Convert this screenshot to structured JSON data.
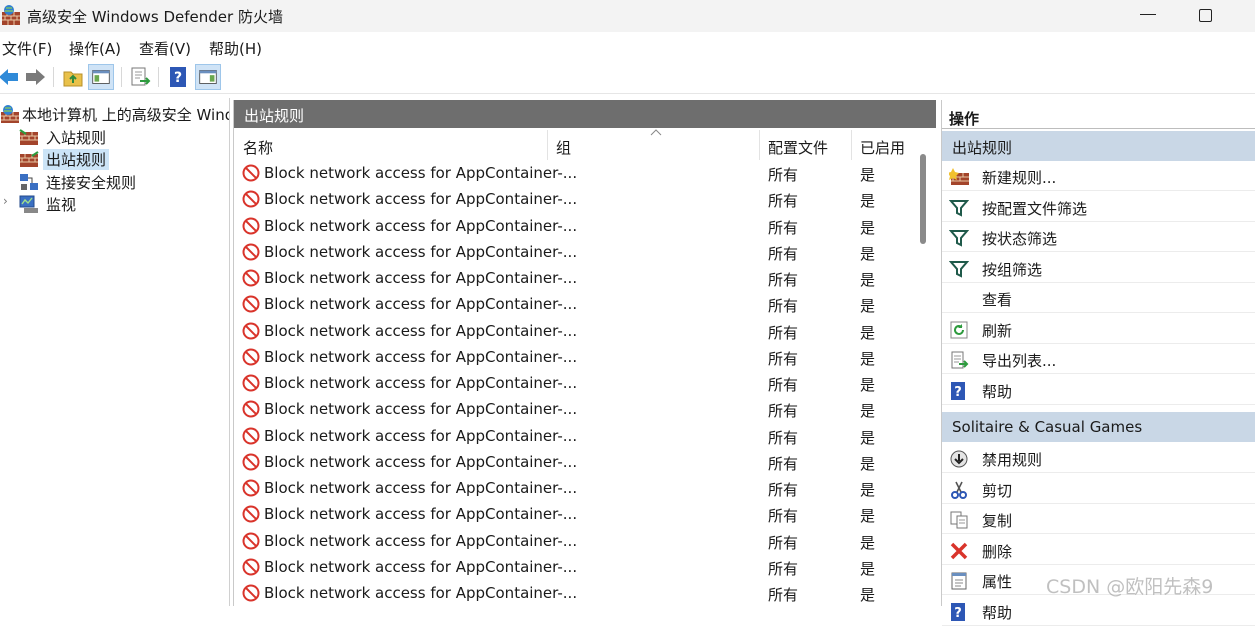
{
  "window": {
    "title": "高级安全 Windows Defender 防火墙"
  },
  "menu": [
    "文件(F)",
    "操作(A)",
    "查看(V)",
    "帮助(H)"
  ],
  "tree": {
    "root": "本地计算机 上的高级安全 Windows Defender 防火墙",
    "items": [
      "入站规则",
      "出站规则",
      "连接安全规则",
      "监视"
    ],
    "selected": "出站规则"
  },
  "panel": {
    "title": "出站规则",
    "columns": [
      "名称",
      "组",
      "配置文件",
      "已启用"
    ],
    "rows": [
      {
        "name": "Block network access for AppContainer-...",
        "group": "",
        "profile": "所有",
        "enabled": "是"
      },
      {
        "name": "Block network access for AppContainer-...",
        "group": "",
        "profile": "所有",
        "enabled": "是"
      },
      {
        "name": "Block network access for AppContainer-...",
        "group": "",
        "profile": "所有",
        "enabled": "是"
      },
      {
        "name": "Block network access for AppContainer-...",
        "group": "",
        "profile": "所有",
        "enabled": "是"
      },
      {
        "name": "Block network access for AppContainer-...",
        "group": "",
        "profile": "所有",
        "enabled": "是"
      },
      {
        "name": "Block network access for AppContainer-...",
        "group": "",
        "profile": "所有",
        "enabled": "是"
      },
      {
        "name": "Block network access for AppContainer-...",
        "group": "",
        "profile": "所有",
        "enabled": "是"
      },
      {
        "name": "Block network access for AppContainer-...",
        "group": "",
        "profile": "所有",
        "enabled": "是"
      },
      {
        "name": "Block network access for AppContainer-...",
        "group": "",
        "profile": "所有",
        "enabled": "是"
      },
      {
        "name": "Block network access for AppContainer-...",
        "group": "",
        "profile": "所有",
        "enabled": "是"
      },
      {
        "name": "Block network access for AppContainer-...",
        "group": "",
        "profile": "所有",
        "enabled": "是"
      },
      {
        "name": "Block network access for AppContainer-...",
        "group": "",
        "profile": "所有",
        "enabled": "是"
      },
      {
        "name": "Block network access for AppContainer-...",
        "group": "",
        "profile": "所有",
        "enabled": "是"
      },
      {
        "name": "Block network access for AppContainer-...",
        "group": "",
        "profile": "所有",
        "enabled": "是"
      },
      {
        "name": "Block network access for AppContainer-...",
        "group": "",
        "profile": "所有",
        "enabled": "是"
      },
      {
        "name": "Block network access for AppContainer-...",
        "group": "",
        "profile": "所有",
        "enabled": "是"
      },
      {
        "name": "Block network access for AppContainer-...",
        "group": "",
        "profile": "所有",
        "enabled": "是"
      }
    ]
  },
  "actions": {
    "title": "操作",
    "section1": {
      "title": "出站规则",
      "items": [
        {
          "label": "新建规则...",
          "icon": "new-rule-icon"
        },
        {
          "label": "按配置文件筛选",
          "icon": "filter-icon"
        },
        {
          "label": "按状态筛选",
          "icon": "filter-icon"
        },
        {
          "label": "按组筛选",
          "icon": "filter-icon"
        },
        {
          "label": "查看",
          "icon": ""
        },
        {
          "label": "刷新",
          "icon": "refresh-icon"
        },
        {
          "label": "导出列表...",
          "icon": "export-list-icon"
        },
        {
          "label": "帮助",
          "icon": "help-icon"
        }
      ]
    },
    "section2": {
      "title": "Solitaire & Casual Games",
      "items": [
        {
          "label": "禁用规则",
          "icon": "disable-rule-icon"
        },
        {
          "label": "剪切",
          "icon": "cut-icon"
        },
        {
          "label": "复制",
          "icon": "copy-icon"
        },
        {
          "label": "删除",
          "icon": "delete-icon"
        },
        {
          "label": "属性",
          "icon": "properties-icon"
        },
        {
          "label": "帮助",
          "icon": "help-icon"
        }
      ]
    }
  },
  "watermark": "CSDN @欧阳先森9",
  "colors": {
    "panel_header": "#6e6e6e",
    "section_header": "#c9d7e6",
    "selection": "#cce4f7",
    "block_red": "#d9342b"
  }
}
